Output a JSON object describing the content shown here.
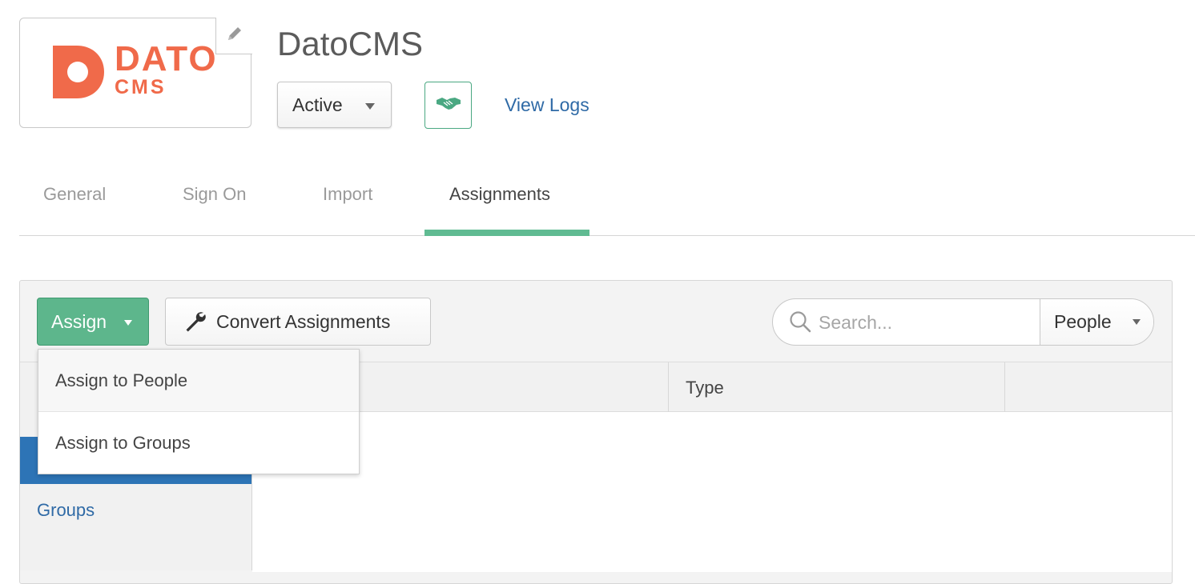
{
  "app": {
    "title": "DatoCMS",
    "logo": {
      "word_top": "DATO",
      "word_bottom": "CMS",
      "brand_color": "#f06a4a"
    },
    "status": {
      "label": "Active",
      "icon": "chevron-down-icon"
    },
    "handshake_icon": "handshake-icon",
    "view_logs_label": "View Logs"
  },
  "tabs": [
    {
      "label": "General",
      "active": false
    },
    {
      "label": "Sign On",
      "active": false
    },
    {
      "label": "Import",
      "active": false
    },
    {
      "label": "Assignments",
      "active": true
    }
  ],
  "toolbar": {
    "assign_label": "Assign",
    "convert_label": "Convert Assignments",
    "search_placeholder": "Search...",
    "filter_selected": "People"
  },
  "assign_menu": [
    {
      "label": "Assign to People"
    },
    {
      "label": "Assign to Groups"
    }
  ],
  "table": {
    "columns": [
      "",
      "Type",
      ""
    ]
  },
  "sidebar": {
    "items": [
      {
        "label": "Groups"
      }
    ]
  },
  "colors": {
    "accent_green": "#5db68c",
    "tab_underline": "#60bb92",
    "link_blue": "#2f6aa6",
    "selected_blue": "#2d74b6"
  }
}
